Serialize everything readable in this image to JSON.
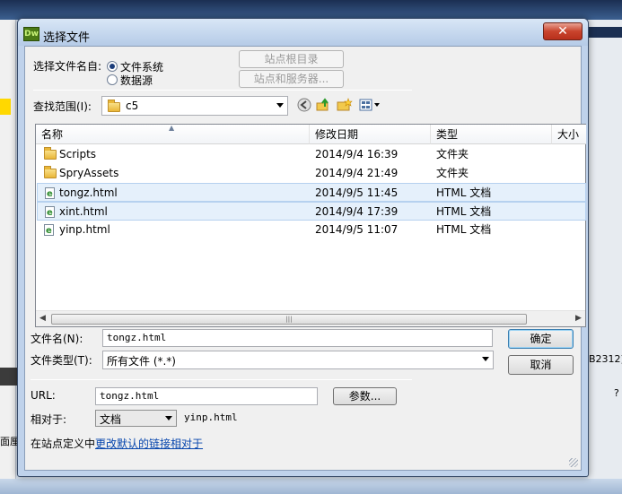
{
  "background": {
    "fragment_code": "B2312)",
    "fragment_face": "面厘",
    "fragment_q": "?"
  },
  "dialog": {
    "title": "选择文件",
    "app_icon": "Dw",
    "close_symbol": "✕",
    "select_from_label": "选择文件名自:",
    "radio_filesystem": "文件系统",
    "radio_datasource": "数据源",
    "btn_site_root": "站点根目录",
    "btn_site_server": "站点和服务器...",
    "lookin_label": "查找范围(I):",
    "lookin_value": "c5",
    "columns": [
      "名称",
      "修改日期",
      "类型",
      "大小"
    ],
    "files": [
      {
        "name": "Scripts",
        "date": "2014/9/4 16:39",
        "type": "文件夹",
        "kind": "folder"
      },
      {
        "name": "SpryAssets",
        "date": "2014/9/4 21:49",
        "type": "文件夹",
        "kind": "folder"
      },
      {
        "name": "tongz.html",
        "date": "2014/9/5 11:45",
        "type": "HTML 文档",
        "kind": "html"
      },
      {
        "name": "xint.html",
        "date": "2014/9/4 17:39",
        "type": "HTML 文档",
        "kind": "html"
      },
      {
        "name": "yinp.html",
        "date": "2014/9/5 11:07",
        "type": "HTML 文档",
        "kind": "html"
      }
    ],
    "filename_label": "文件名(N):",
    "filename_value": "tongz.html",
    "filetype_label": "文件类型(T):",
    "filetype_value": "所有文件 (*.*)",
    "btn_ok": "确定",
    "btn_cancel": "取消",
    "url_label": "URL:",
    "url_value": "tongz.html",
    "btn_params": "参数...",
    "relative_label": "相对于:",
    "relative_value": "文档",
    "relative_file": "yinp.html",
    "site_def_prefix": "在站点定义中",
    "site_def_link": "更改默认的链接相对于"
  }
}
